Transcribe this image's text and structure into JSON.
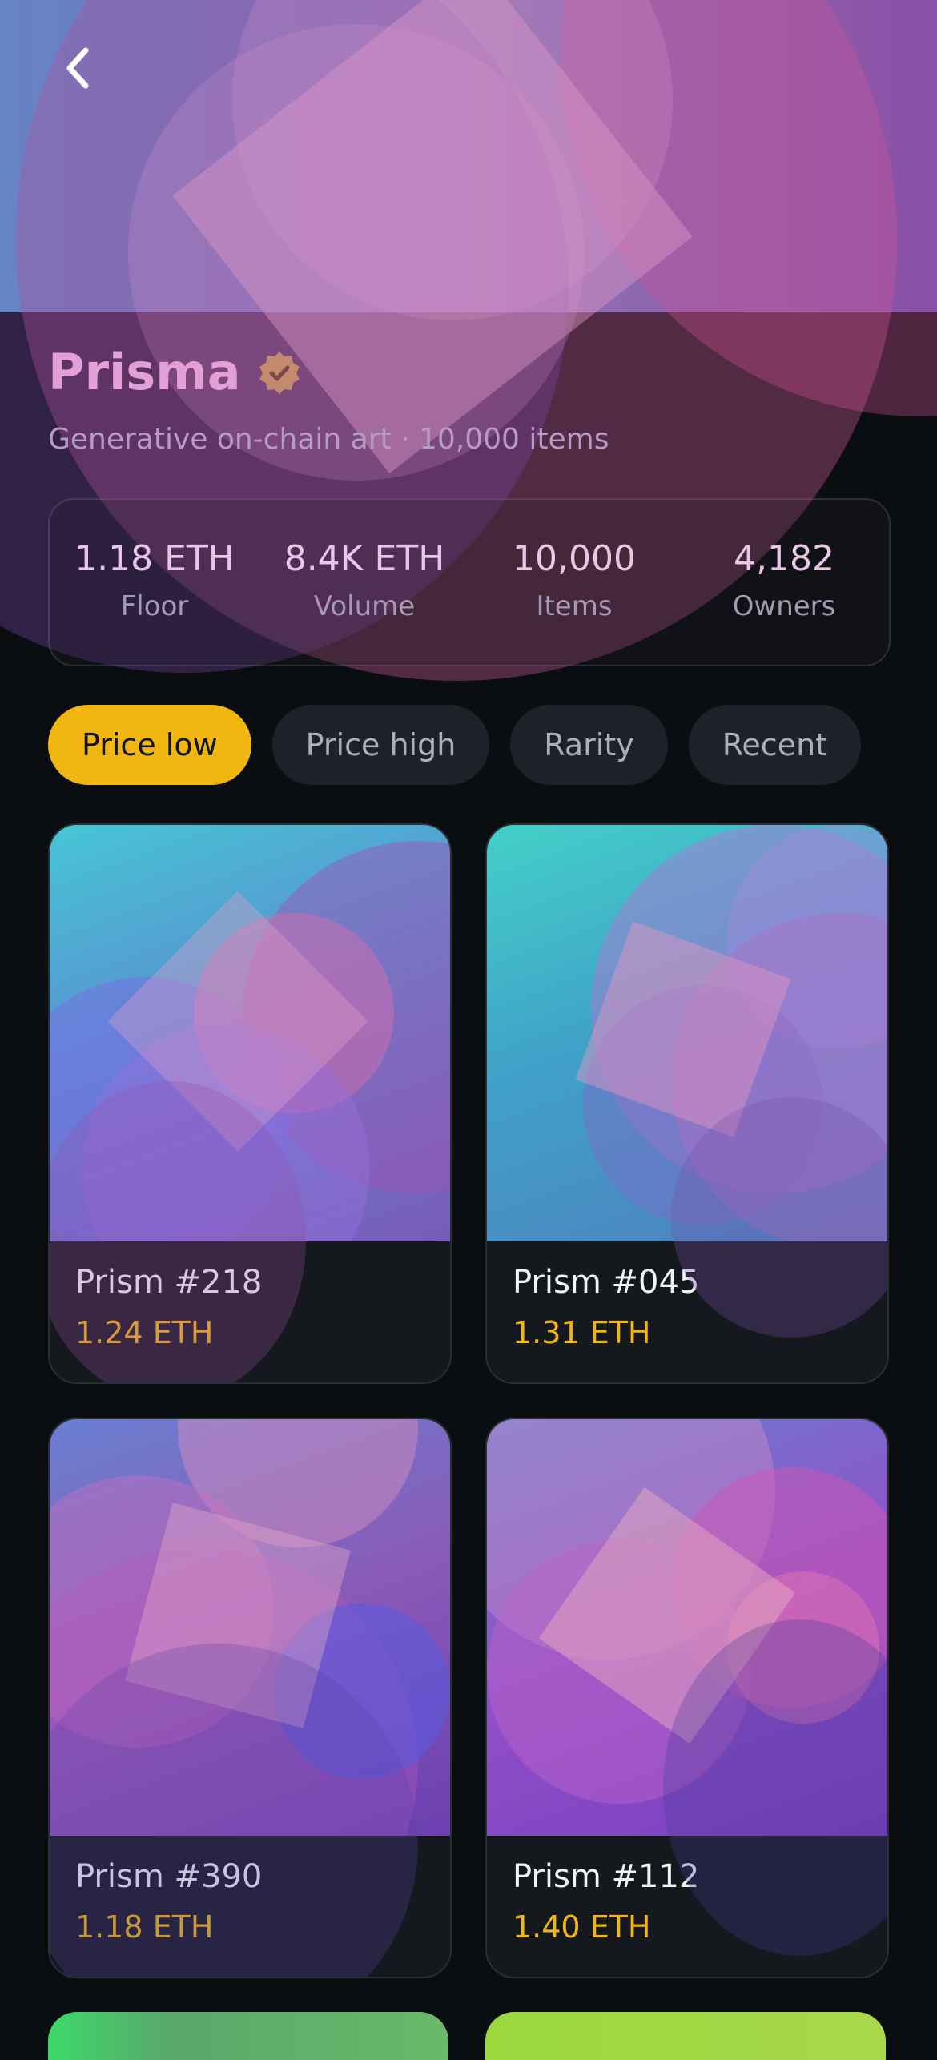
{
  "collection": {
    "name": "Prisma",
    "subtitle": "Generative on-chain art · 10,000 items",
    "verified_icon": "verified-badge-icon"
  },
  "nav": {
    "back_icon": "chevron-left-icon"
  },
  "stats": [
    {
      "value": "1.18 ETH",
      "label": "Floor"
    },
    {
      "value": "8.4K ETH",
      "label": "Volume"
    },
    {
      "value": "10,000",
      "label": "Items"
    },
    {
      "value": "4,182",
      "label": "Owners"
    }
  ],
  "sort_chips": [
    {
      "label": "Price low",
      "active": true
    },
    {
      "label": "Price high",
      "active": false
    },
    {
      "label": "Rarity",
      "active": false
    },
    {
      "label": "Recent",
      "active": false
    }
  ],
  "items": [
    {
      "name": "Prism #218",
      "price": "1.24 ETH"
    },
    {
      "name": "Prism #045",
      "price": "1.31 ETH"
    },
    {
      "name": "Prism #390",
      "price": "1.18 ETH"
    },
    {
      "name": "Prism #112",
      "price": "1.40 ETH"
    }
  ],
  "colors": {
    "accent": "#f1b710",
    "background": "#0b0e11",
    "card": "#15181d"
  }
}
